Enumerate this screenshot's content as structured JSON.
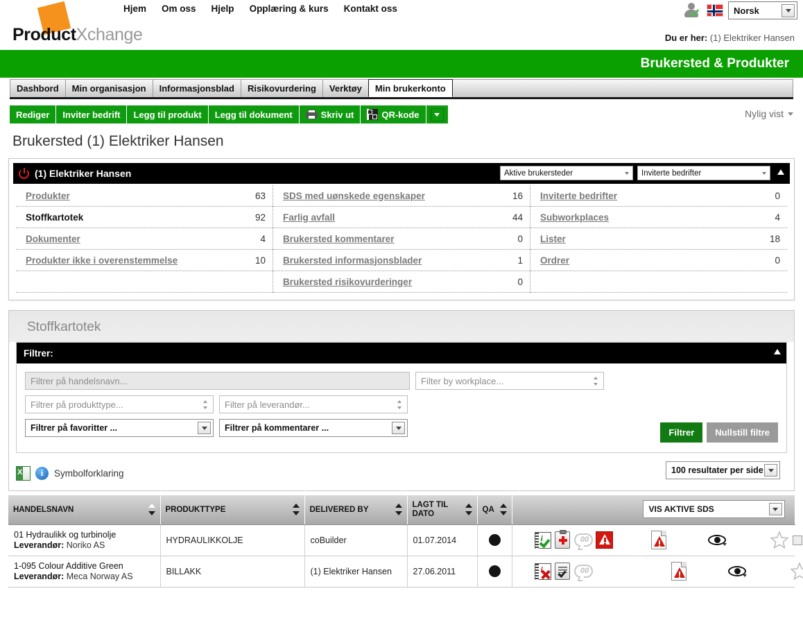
{
  "brand": {
    "name_bold": "Product",
    "name_light": "Xchange"
  },
  "topnav": [
    {
      "label": "Hjem"
    },
    {
      "label": "Om oss"
    },
    {
      "label": "Hjelp"
    },
    {
      "label": "Opplæring & kurs"
    },
    {
      "label": "Kontakt oss"
    }
  ],
  "user": {
    "language_selected": "Norsk",
    "flag": "norway-flag-icon",
    "account_icon": "user-verified-icon"
  },
  "breadcrumb": {
    "label": "Du er her:",
    "value": "(1) Elektriker Hansen"
  },
  "banner": {
    "title": "Brukersted & Produkter",
    "color": "#0aa000"
  },
  "tabs": [
    {
      "label": "Dashbord",
      "active": false
    },
    {
      "label": "Min organisasjon",
      "active": false
    },
    {
      "label": "Informasjonsblad",
      "active": false
    },
    {
      "label": "Risikovurdering",
      "active": false
    },
    {
      "label": "Verktøy",
      "active": false
    },
    {
      "label": "Min brukerkonto",
      "active": true
    }
  ],
  "toolbar": {
    "buttons": [
      {
        "label": "Rediger",
        "icon": null
      },
      {
        "label": "Inviter bedrift",
        "icon": null
      },
      {
        "label": "Legg til produkt",
        "icon": null
      },
      {
        "label": "Legg til dokument",
        "icon": null
      },
      {
        "label": "Skriv ut",
        "icon": "printer-icon"
      },
      {
        "label": "QR-kode",
        "icon": "qr-code-icon"
      }
    ],
    "recently_viewed": "Nylig vist"
  },
  "page_title": "Brukersted (1) Elektriker Hansen",
  "info_panel": {
    "heading": "(1) Elektriker Hansen",
    "select_workplaces": "Aktive brukersteder",
    "select_companies": "Inviterte bedrifter",
    "columns": [
      [
        {
          "label": "Produkter",
          "value": "63",
          "bold": false
        },
        {
          "label": "Stoffkartotek",
          "value": "92",
          "bold": true
        },
        {
          "label": "Dokumenter",
          "value": "4",
          "bold": false
        },
        {
          "label": "Produkter ikke i overenstemmelse",
          "value": "10",
          "bold": false
        },
        {
          "label": "",
          "value": "",
          "bold": false
        }
      ],
      [
        {
          "label": "SDS med uønskede egenskaper",
          "value": "16",
          "bold": false
        },
        {
          "label": "Farlig avfall",
          "value": "44",
          "bold": false
        },
        {
          "label": "Brukersted kommentarer",
          "value": "0",
          "bold": false
        },
        {
          "label": "Brukersted informasjonsblader",
          "value": "1",
          "bold": false
        },
        {
          "label": "Brukersted risikovurderinger",
          "value": "0",
          "bold": false
        }
      ],
      [
        {
          "label": "Inviterte bedrifter",
          "value": "0",
          "bold": false
        },
        {
          "label": "Subworkplaces",
          "value": "4",
          "bold": false
        },
        {
          "label": "Lister",
          "value": "18",
          "bold": false
        },
        {
          "label": "Ordrer",
          "value": "0",
          "bold": false
        },
        {
          "label": "",
          "value": "",
          "bold": false
        }
      ]
    ]
  },
  "section": {
    "title": "Stoffkartotek"
  },
  "filters": {
    "heading": "Filtrer:",
    "trade_name_placeholder": "Filtrer på handelsnavn...",
    "workplace_placeholder": "Filter by workplace...",
    "product_type_placeholder": "Filtrer på produkttype...",
    "supplier_placeholder": "Filter på leverandør...",
    "favourites_placeholder": "Filtrer på favoritter ...",
    "comments_placeholder": "Filtrer på kommentarer ...",
    "apply_label": "Filtrer",
    "reset_label": "Nullstill filtre"
  },
  "legend": {
    "label": "Symbolforklaring",
    "excel_icon": "excel-export-icon",
    "info_icon": "info-icon"
  },
  "results_per_page": "100 resultater per side",
  "table": {
    "columns": [
      {
        "label": "HANDELSNAVN",
        "sorted": "asc"
      },
      {
        "label": "PRODUKTTYPE",
        "sorted": "none"
      },
      {
        "label": "DELIVERED BY",
        "sorted": "none"
      },
      {
        "label": "LAGT TIL DATO",
        "sorted": "none"
      },
      {
        "label": "QA",
        "sorted": "none"
      },
      {
        "label": "",
        "sorted": null
      }
    ],
    "active_sds_select": "VIS AKTIVE SDS",
    "rows": [
      {
        "name": "01 Hydraulikk og turbinolje",
        "supplier_label": "Leverandør:",
        "supplier": "Noriko AS",
        "product_type": "HYDRAULIKKOLJE",
        "delivered_by": "coBuilder",
        "added_date": "01.07.2014",
        "qa": "filled",
        "icons": [
          "sds-info-ok-icon",
          "first-aid-icon",
          "comment-count-icon",
          "hazard-warning-icon",
          "document-warning-icon",
          "eye-view-icon",
          "favourite-star-icon",
          "select-checkbox"
        ],
        "comment_count": "00",
        "has_hazard_square": true,
        "note_state": "check"
      },
      {
        "name": "1-095 Colour Additive Green",
        "supplier_label": "Leverandør:",
        "supplier": "Meca Norway AS",
        "product_type": "BILLAKK",
        "delivered_by": "(1) Elektriker Hansen",
        "added_date": "27.06.2011",
        "qa": "filled",
        "icons": [
          "sds-info-missing-icon",
          "checklist-icon",
          "comment-count-icon",
          "document-warning-icon",
          "eye-view-icon",
          "favourite-star-icon",
          "select-checkbox"
        ],
        "comment_count": "00",
        "has_hazard_square": false,
        "note_state": "cross"
      }
    ]
  }
}
